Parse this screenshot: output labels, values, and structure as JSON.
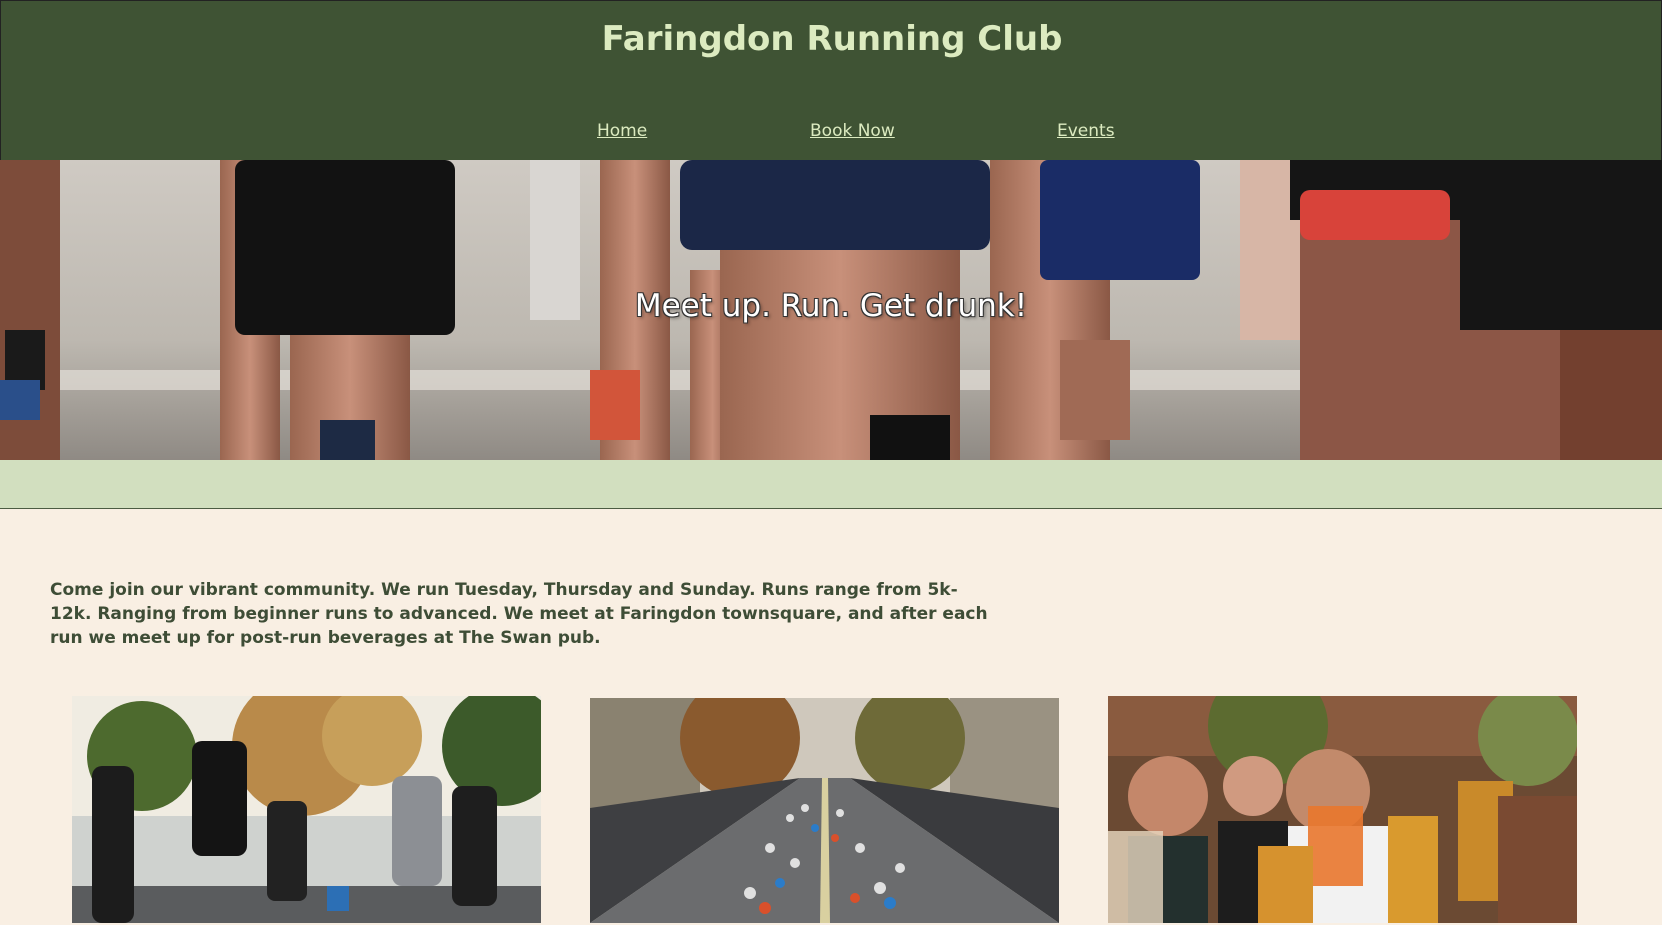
{
  "header": {
    "title": "Faringdon Running Club",
    "nav": [
      {
        "label": "Home"
      },
      {
        "label": "Book Now"
      },
      {
        "label": "Events"
      }
    ]
  },
  "hero": {
    "tagline": "Meet up. Run. Get drunk!"
  },
  "intro": {
    "text": "Come join our vibrant community. We run Tuesday, Thursday and Sunday. Runs range from 5k-12k. Ranging from beginner runs to advanced. We meet at Faringdon townsquare, and after each run we meet up for post-run beverages at The Swan pub."
  },
  "colors": {
    "header_bg": "#3f5334",
    "header_text": "#dcebc0",
    "band": "#d2dfbf",
    "page_bg": "#f9efe3",
    "body_text": "#3e4d36"
  }
}
